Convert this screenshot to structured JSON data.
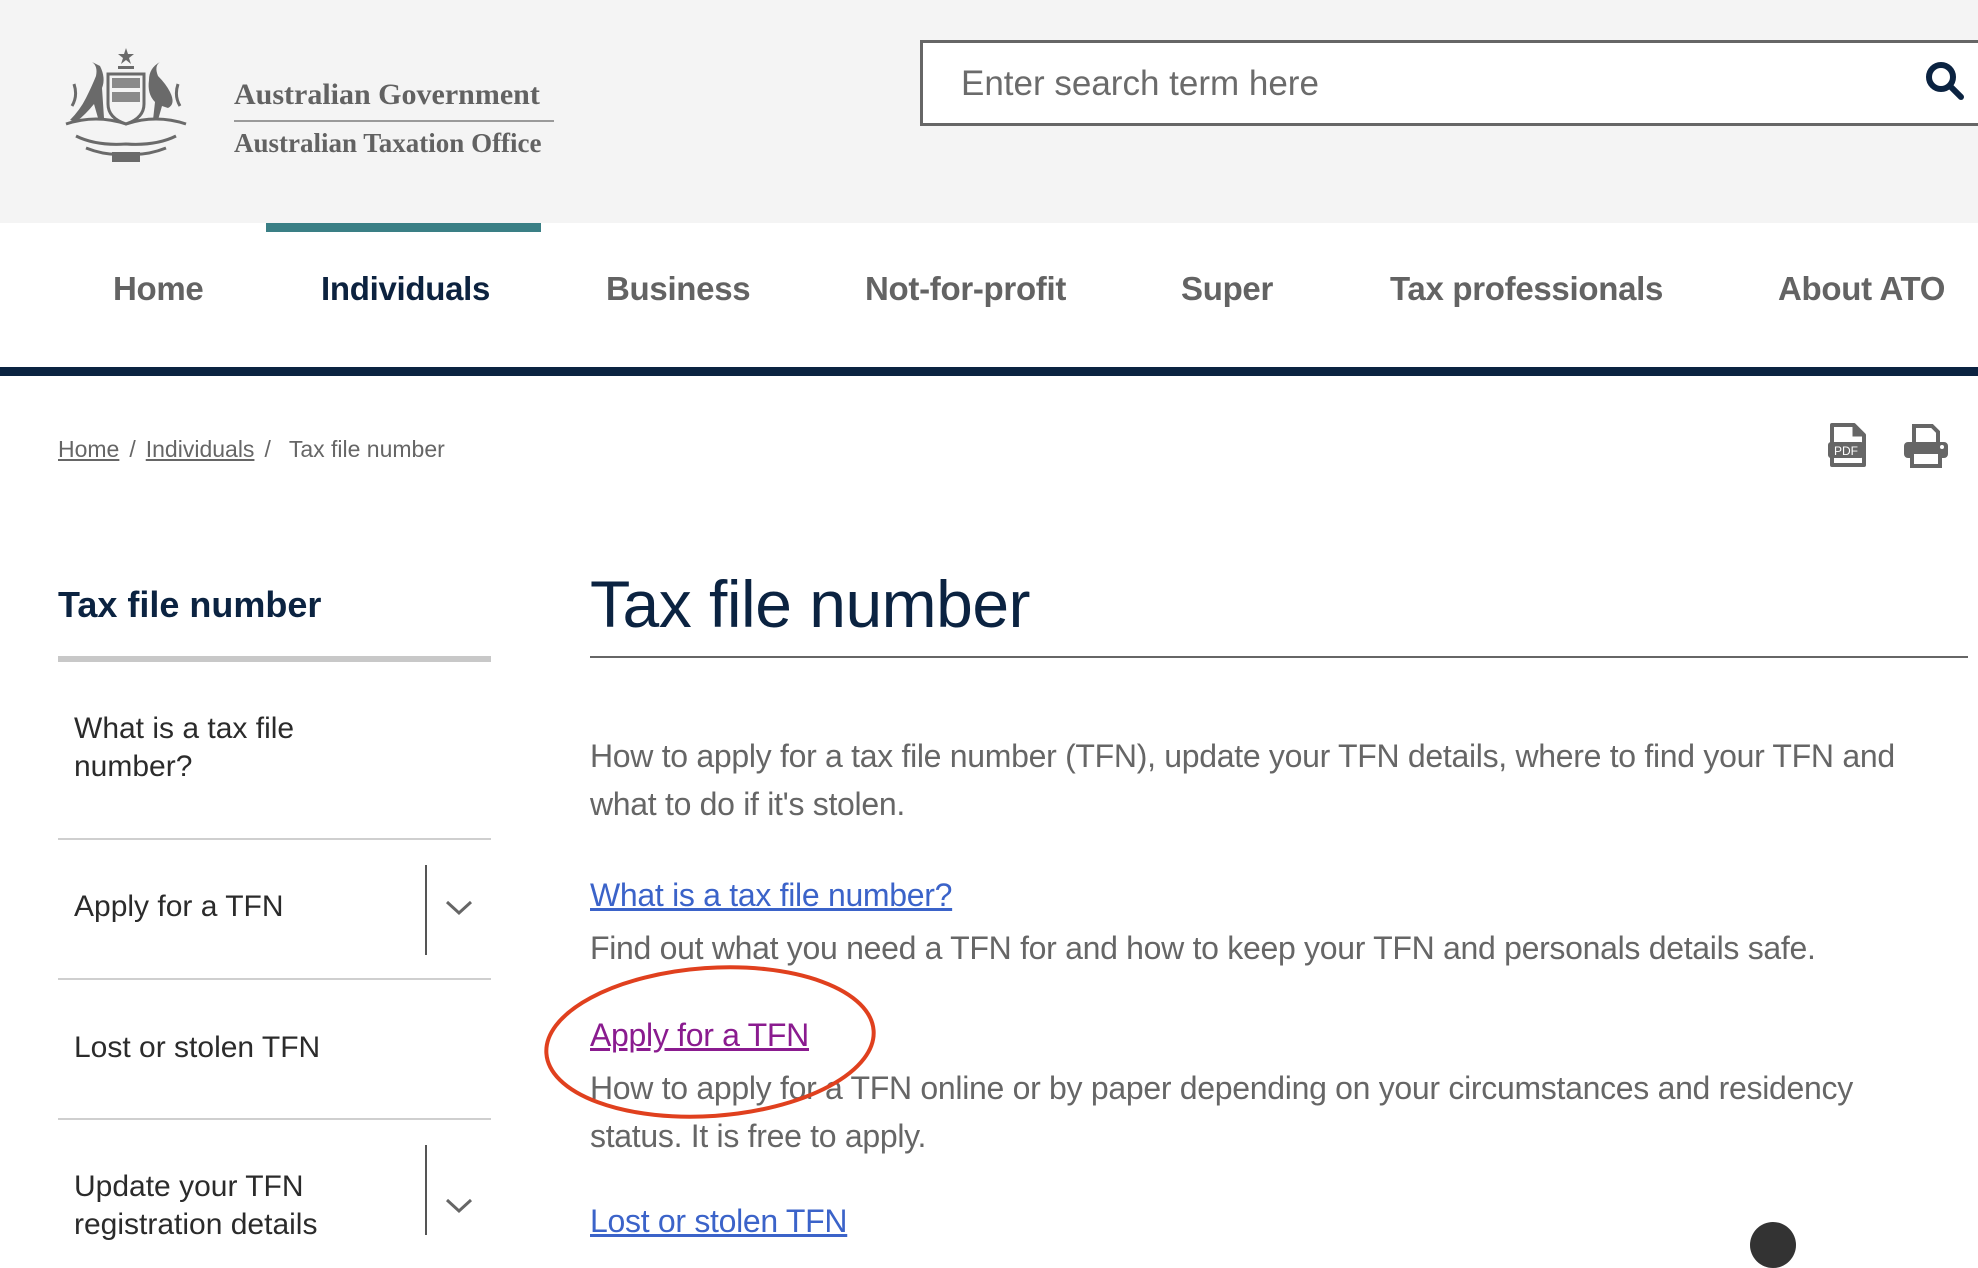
{
  "header": {
    "logo_line1": "Australian Government",
    "logo_line2": "Australian Taxation Office",
    "search": {
      "placeholder": "Enter search term here",
      "value": "",
      "button_icon": "search-icon"
    }
  },
  "nav": {
    "items": [
      {
        "label": "Home",
        "active": false
      },
      {
        "label": "Individuals",
        "active": true
      },
      {
        "label": "Business",
        "active": false
      },
      {
        "label": "Not-for-profit",
        "active": false
      },
      {
        "label": "Super",
        "active": false
      },
      {
        "label": "Tax professionals",
        "active": false
      },
      {
        "label": "About ATO",
        "active": false
      }
    ]
  },
  "breadcrumb": {
    "items": [
      {
        "label": "Home",
        "link": true
      },
      {
        "label": "Individuals",
        "link": true
      },
      {
        "label": "Tax file number",
        "link": false
      }
    ],
    "separator": "/"
  },
  "page_tools": {
    "pdf_icon": "pdf-icon",
    "print_icon": "printer-icon"
  },
  "sidebar": {
    "heading": "Tax file number",
    "items": [
      {
        "label": "What is a tax file number?",
        "expandable": false
      },
      {
        "label": "Apply for a TFN",
        "expandable": true
      },
      {
        "label": "Lost or stolen TFN",
        "expandable": false
      },
      {
        "label": "Update your TFN registration details",
        "expandable": true
      }
    ]
  },
  "main": {
    "title": "Tax file number",
    "intro": "How to apply for a tax file number (TFN), update your TFN details, where to find your TFN and what to do if it's stolen.",
    "links": [
      {
        "label": "What is a tax file number?",
        "description": "Find out what you need a TFN for and how to keep your TFN and personals details safe.",
        "visited": false
      },
      {
        "label": "Apply for a TFN",
        "description": "How to apply for a TFN online or by paper depending on your circumstances and residency status. It is free to apply.",
        "visited": true,
        "annotated": true
      },
      {
        "label": "Lost or stolen TFN",
        "description": "",
        "visited": false
      }
    ]
  },
  "colors": {
    "brand_navy": "#0b2341",
    "active_teal": "#3a7f85",
    "link": "#3b63c9",
    "visited_link": "#8a1b8f",
    "annotation_red": "#e0401e",
    "header_bg": "#f4f4f4"
  }
}
